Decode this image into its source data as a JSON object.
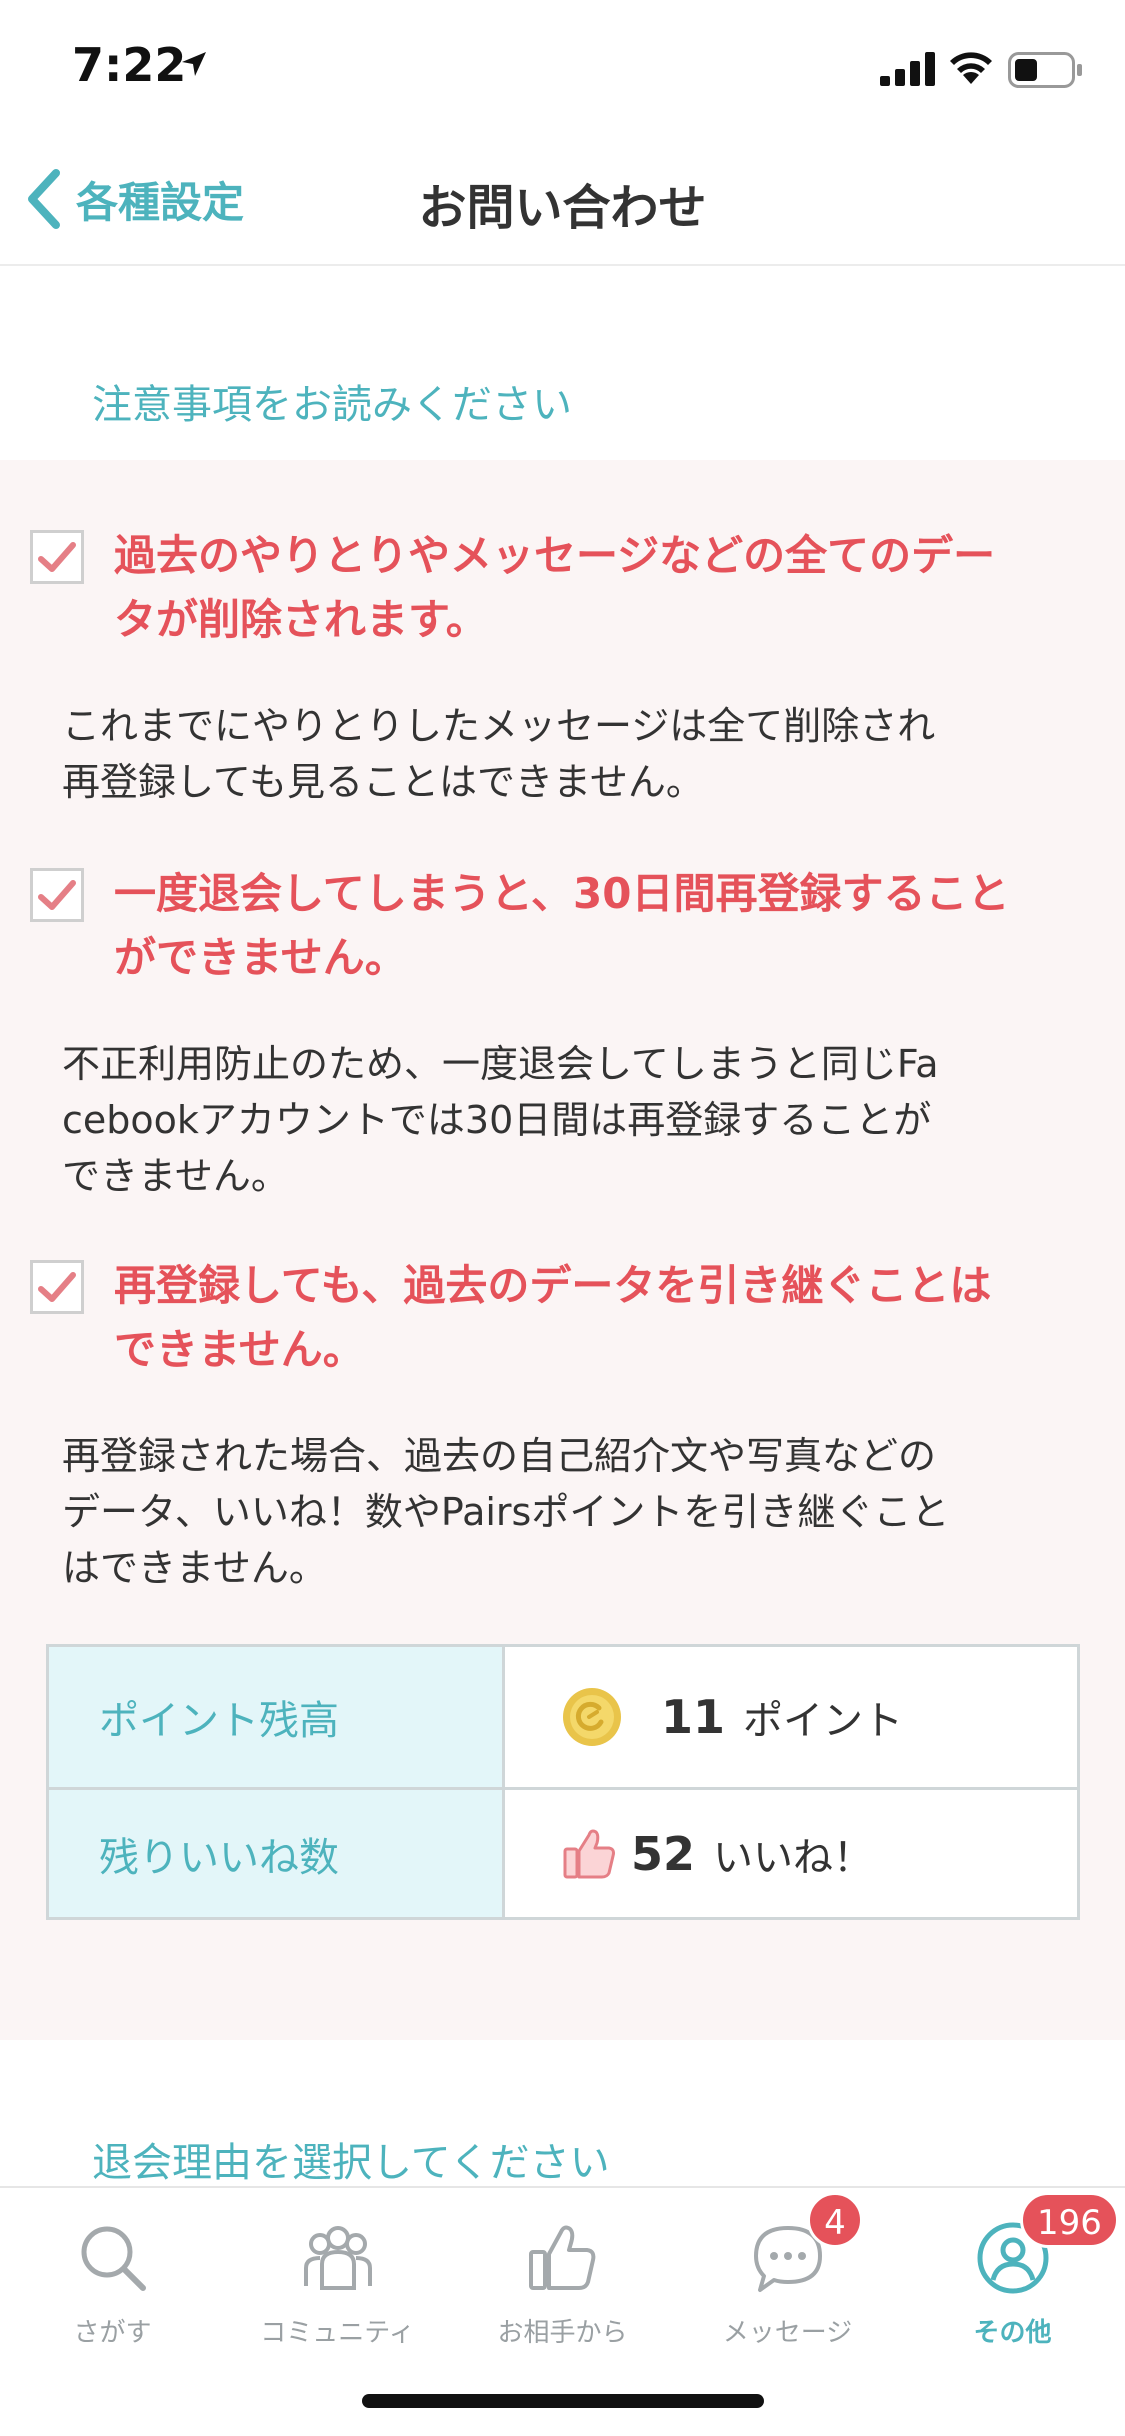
{
  "status_bar": {
    "time": "7:22"
  },
  "nav": {
    "back_label": "各種設定",
    "title": "お問い合わせ"
  },
  "notice": {
    "header": "注意事項をお読みください",
    "items": [
      {
        "title_lines": [
          "過去のやりとりやメッセージなどの全てのデー",
          "タが削除されます。"
        ],
        "body_lines": [
          "これまでにやりとりしたメッセージは全て削除され",
          "再登録しても見ることはできません。"
        ]
      },
      {
        "title_lines": [
          "一度退会してしまうと、30日間再登録すること",
          "ができません。"
        ],
        "body_lines": [
          "不正利用防止のため、一度退会してしまうと同じFa",
          "cebookアカウントでは30日間は再登録することが",
          "できません。"
        ]
      },
      {
        "title_lines": [
          "再登録しても、過去のデータを引き継ぐことは",
          "できません。"
        ],
        "body_lines": [
          "再登録された場合、過去の自己紹介文や写真などの",
          "データ、いいね！数やPairsポイントを引き継ぐこと",
          "はできません。"
        ]
      }
    ]
  },
  "info_table": {
    "points_label": "ポイント残高",
    "points_value": "11",
    "points_unit": "ポイント",
    "likes_label": "残りいいね数",
    "likes_value": "52",
    "likes_unit": "いいね！"
  },
  "reason_header": "退会理由を選択してください",
  "tabs": [
    {
      "label": "さがす",
      "icon": "search-icon"
    },
    {
      "label": "コミュニティ",
      "icon": "community-icon"
    },
    {
      "label": "お相手から",
      "icon": "thumbs-up-icon"
    },
    {
      "label": "メッセージ",
      "icon": "message-icon",
      "badge": "4"
    },
    {
      "label": "その他",
      "icon": "profile-icon",
      "badge": "196",
      "active": true
    }
  ],
  "colors": {
    "accent": "#4db3bd",
    "warning": "#e5525a",
    "panel": "#fbf5f5"
  }
}
